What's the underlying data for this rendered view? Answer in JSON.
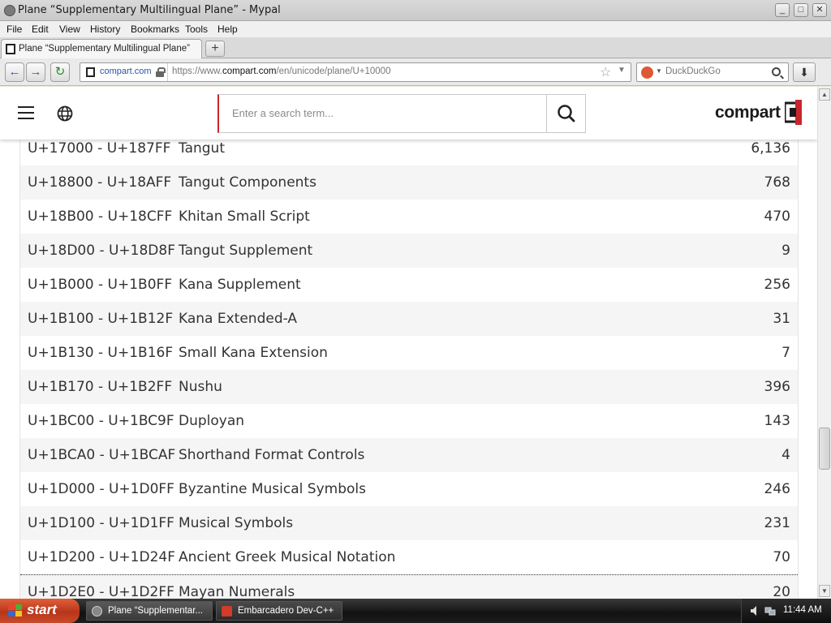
{
  "window": {
    "title": "Plane “Supplementary Multilingual Plane” - Mypal",
    "min": "_",
    "max": "□",
    "close": "✕"
  },
  "menu": [
    "File",
    "Edit",
    "View",
    "History",
    "Bookmarks",
    "Tools",
    "Help"
  ],
  "tab": {
    "label": "Plane “Supplementary Multilingual Plane”",
    "new_tab": "+"
  },
  "nav": {
    "back": "←",
    "forward": "→",
    "reload": "↻",
    "site_name": "compart.com",
    "url_prefix": "https://www.",
    "url_domain": "compart.com",
    "url_path": "/en/unicode/plane/U+10000",
    "search_engine_placeholder": "DuckDuckGo",
    "download": "⬇"
  },
  "site": {
    "search_placeholder": "Enter a search term...",
    "logo": "compart"
  },
  "table": [
    {
      "range": "U+17000 - U+187FF",
      "name": "Tangut",
      "count": "6,136"
    },
    {
      "range": "U+18800 - U+18AFF",
      "name": "Tangut Components",
      "count": "768"
    },
    {
      "range": "U+18B00 - U+18CFF",
      "name": "Khitan Small Script",
      "count": "470"
    },
    {
      "range": "U+18D00 - U+18D8F",
      "name": "Tangut Supplement",
      "count": "9"
    },
    {
      "range": "U+1B000 - U+1B0FF",
      "name": "Kana Supplement",
      "count": "256"
    },
    {
      "range": "U+1B100 - U+1B12F",
      "name": "Kana Extended-A",
      "count": "31"
    },
    {
      "range": "U+1B130 - U+1B16F",
      "name": "Small Kana Extension",
      "count": "7"
    },
    {
      "range": "U+1B170 - U+1B2FF",
      "name": "Nushu",
      "count": "396"
    },
    {
      "range": "U+1BC00 - U+1BC9F",
      "name": "Duployan",
      "count": "143"
    },
    {
      "range": "U+1BCA0 - U+1BCAF",
      "name": "Shorthand Format Controls",
      "count": "4"
    },
    {
      "range": "U+1D000 - U+1D0FF",
      "name": "Byzantine Musical Symbols",
      "count": "246"
    },
    {
      "range": "U+1D100 - U+1D1FF",
      "name": "Musical Symbols",
      "count": "231"
    },
    {
      "range": "U+1D200 - U+1D24F",
      "name": "Ancient Greek Musical Notation",
      "count": "70"
    },
    {
      "range": "U+1D2E0 - U+1D2FF",
      "name": "Mayan Numerals",
      "count": "20"
    }
  ],
  "taskbar": {
    "start": "start",
    "items": [
      {
        "label": "Plane “Supplementar...",
        "active": true
      },
      {
        "label": "Embarcadero Dev-C++",
        "active": false
      }
    ],
    "clock": "11:44 AM"
  },
  "colors": {
    "accent_red": "#c9262c",
    "row_alt": "#f5f5f5"
  }
}
